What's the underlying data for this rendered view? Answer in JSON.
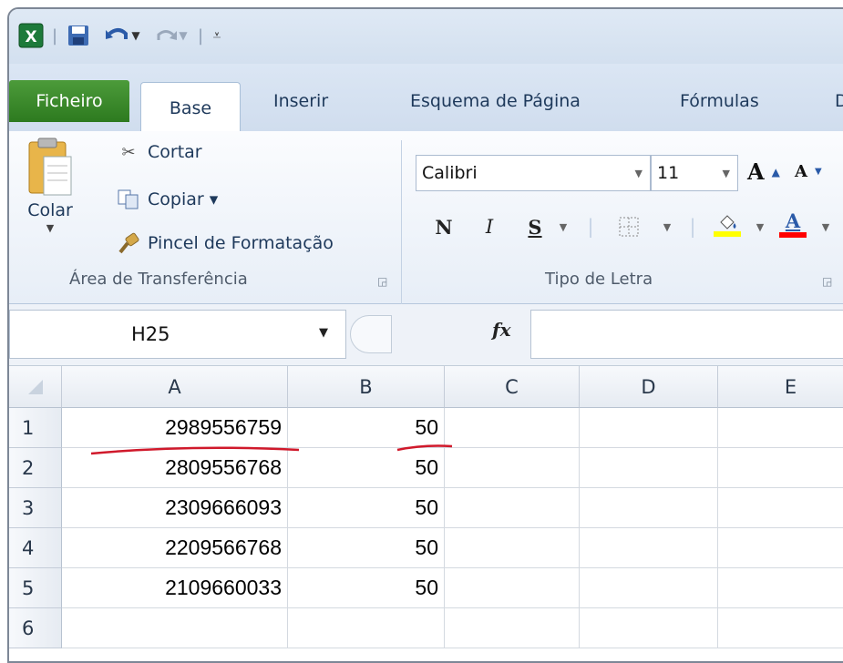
{
  "quick_access": {
    "app_icon": "excel-icon",
    "save_icon": "save-icon",
    "undo_icon": "undo-icon",
    "redo_icon": "redo-icon",
    "customize_icon": "customize-qat-icon"
  },
  "tabs": [
    {
      "label": "Ficheiro"
    },
    {
      "label": "Base"
    },
    {
      "label": "Inserir"
    },
    {
      "label": "Esquema de Página"
    },
    {
      "label": "Fórmulas"
    },
    {
      "label": "D"
    }
  ],
  "clipboard": {
    "paste_label": "Colar",
    "cut_label": "Cortar",
    "copy_label": "Copiar ▾",
    "format_painter_label": "Pincel de Formatação",
    "group_label": "Área de Transferência"
  },
  "font": {
    "font_name": "Calibri",
    "font_size": "11",
    "bold_label": "N",
    "italic_label": "I",
    "underline_label": "S",
    "group_label": "Tipo de Letra",
    "fill_color": "#ffff00",
    "font_color": "#ff0000"
  },
  "formula_bar": {
    "name_box": "H25",
    "fx_label": "fx",
    "formula": ""
  },
  "columns": [
    "A",
    "B",
    "C",
    "D",
    "E"
  ],
  "rows": [
    {
      "num": "1",
      "a": "2989556759",
      "b": "50"
    },
    {
      "num": "2",
      "a": "2809556768",
      "b": "50"
    },
    {
      "num": "3",
      "a": "2309666093",
      "b": "50"
    },
    {
      "num": "4",
      "a": "2209566768",
      "b": "50"
    },
    {
      "num": "5",
      "a": "2109660033",
      "b": "50"
    },
    {
      "num": "6",
      "a": "",
      "b": ""
    }
  ],
  "annotation_color": "#d0192b"
}
